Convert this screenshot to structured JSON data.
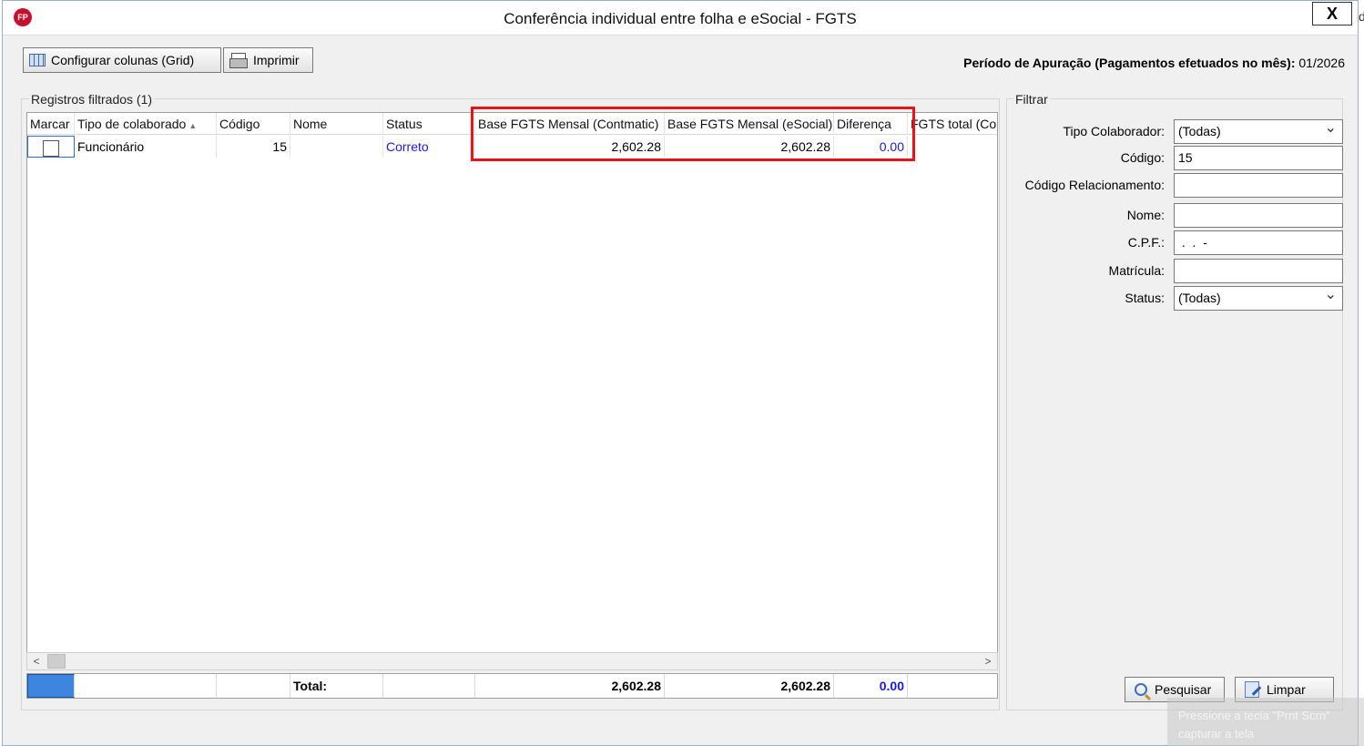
{
  "window": {
    "title": "Conferência individual entre folha e eSocial - FGTS",
    "close_label": "X",
    "app_icon_text": "FP"
  },
  "toolbar": {
    "config_columns_label": "Configurar colunas (Grid)",
    "print_label": "Imprimir",
    "periodo_label": "Período de Apuração (Pagamentos efetuados no mês):",
    "periodo_value": "01/2026"
  },
  "registros": {
    "group_label": "Registros filtrados (1)",
    "columns": {
      "marcar": "Marcar",
      "tipo": "Tipo de colaborado",
      "codigo": "Código",
      "nome": "Nome",
      "status": "Status",
      "base_contmatic": "Base FGTS Mensal (Contmatic)",
      "base_esocial": "Base FGTS Mensal (eSocial)",
      "diferenca": "Diferença",
      "fgts_total": "FGTS total (Co"
    },
    "rows": [
      {
        "tipo": "Funcionário",
        "codigo": "15",
        "nome": "",
        "status": "Correto",
        "base_contmatic": "2,602.28",
        "base_esocial": "2,602.28",
        "diferenca": "0.00"
      }
    ],
    "totals": {
      "label": "Total:",
      "base_contmatic": "2,602.28",
      "base_esocial": "2,602.28",
      "diferenca": "0.00"
    },
    "scroll_left": "<",
    "scroll_right": ">"
  },
  "filtrar": {
    "group_label": "Filtrar",
    "tipo_colaborador_label": "Tipo Colaborador:",
    "tipo_colaborador_value": "(Todas)",
    "codigo_label": "Código:",
    "codigo_value": "15",
    "codigo_relacionamento_label": "Código Relacionamento:",
    "codigo_relacionamento_value": "",
    "nome_label": "Nome:",
    "nome_value": "",
    "cpf_label": "C.P.F.:",
    "cpf_value": " .  .  -",
    "matricula_label": "Matrícula:",
    "matricula_value": "",
    "status_label": "Status:",
    "status_value": "(Todas)",
    "pesquisar_label": "Pesquisar",
    "limpar_label": "Limpar"
  },
  "watermark": {
    "line1": "Pressione a tecla \"Prnt Scrn\"",
    "line2": "capturar a tela"
  },
  "background_edge": {
    "glyph": "d"
  },
  "colors": {
    "highlight_border": "#e8141c",
    "link_blue": "#1a1ad8",
    "selection_blue": "#3d86e0"
  }
}
